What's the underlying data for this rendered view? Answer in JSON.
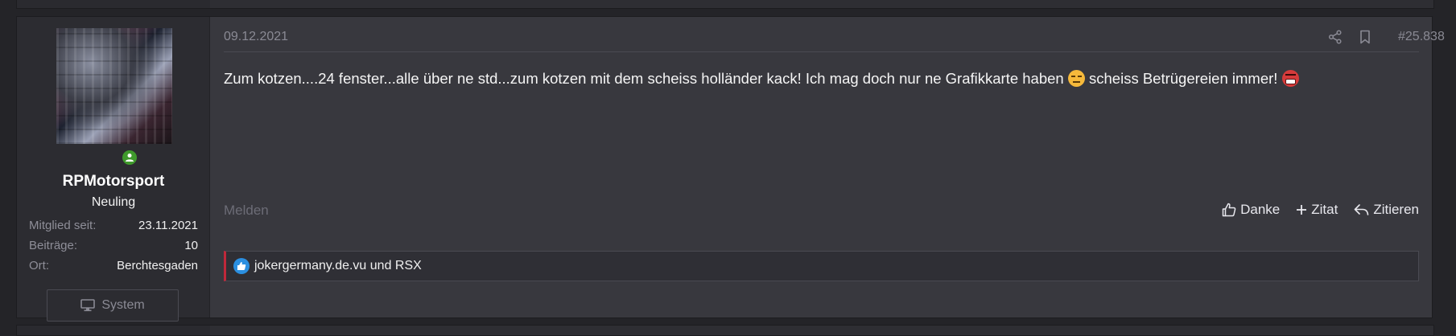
{
  "user": {
    "name": "RPMotorsport",
    "title": "Neuling",
    "info": [
      {
        "key": "Mitglied seit:",
        "value": "23.11.2021"
      },
      {
        "key": "Beiträge:",
        "value": "10"
      },
      {
        "key": "Ort:",
        "value": "Berchtesgaden"
      }
    ],
    "system_label": "System",
    "online_color": "#3f9a2c"
  },
  "post": {
    "date": "09.12.2021",
    "number": "#25.838",
    "message_part1": "Zum kotzen....24 fenster...alle über ne std...zum kotzen mit dem scheiss holländer kack! Ich mag doch nur ne Grafikkarte haben",
    "message_part2": "scheiss Betrügereien immer!",
    "emoji1": "expressionless-face",
    "emoji2": "angry-face",
    "report_label": "Melden",
    "actions": {
      "like": "Danke",
      "quote": "Zitat",
      "reply": "Zitieren"
    },
    "reactions_text": "jokergermany.de.vu und RSX"
  },
  "colors": {
    "background": "#242428",
    "post_bg": "#38383e",
    "accent_red": "#c0283a",
    "like_blue": "#2b8fe0"
  }
}
